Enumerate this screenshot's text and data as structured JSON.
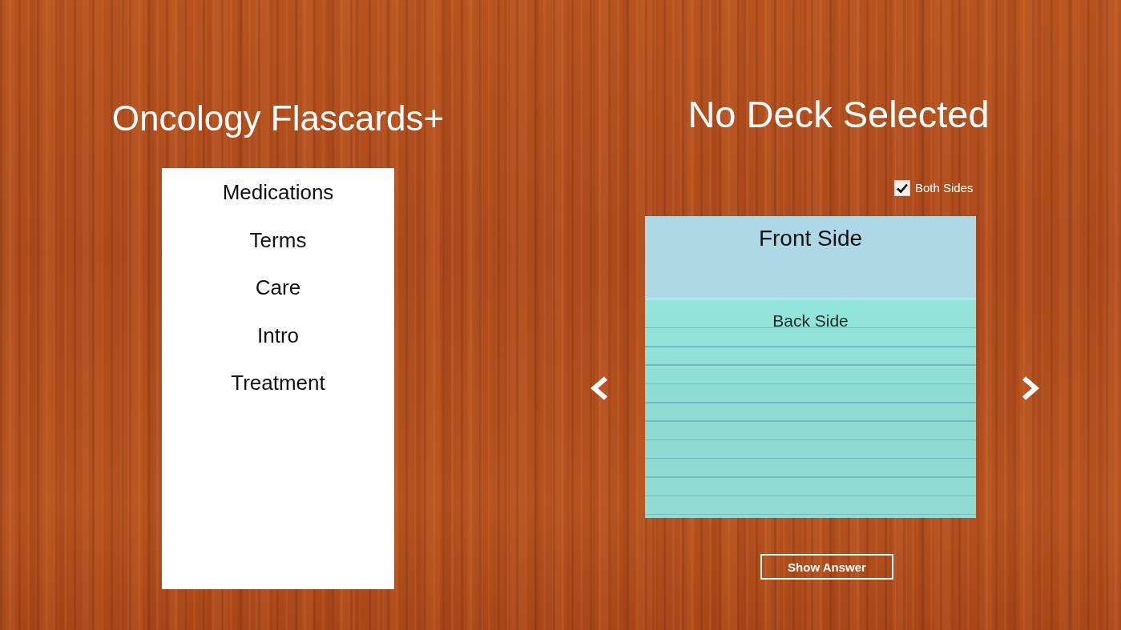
{
  "app": {
    "title": "Oncology Flascards+"
  },
  "decks": [
    {
      "label": "Medications",
      "selected": false
    },
    {
      "label": "Terms",
      "selected": false
    },
    {
      "label": "Care",
      "selected": false
    },
    {
      "label": "Intro",
      "selected": false
    },
    {
      "label": "Treatment",
      "selected": false
    }
  ],
  "viewer": {
    "title": "No Deck Selected",
    "both_sides": {
      "label": "Both Sides",
      "checked": true
    },
    "card": {
      "front": "Front Side",
      "back": "Back Side"
    },
    "show_answer_button": "Show Answer"
  }
}
